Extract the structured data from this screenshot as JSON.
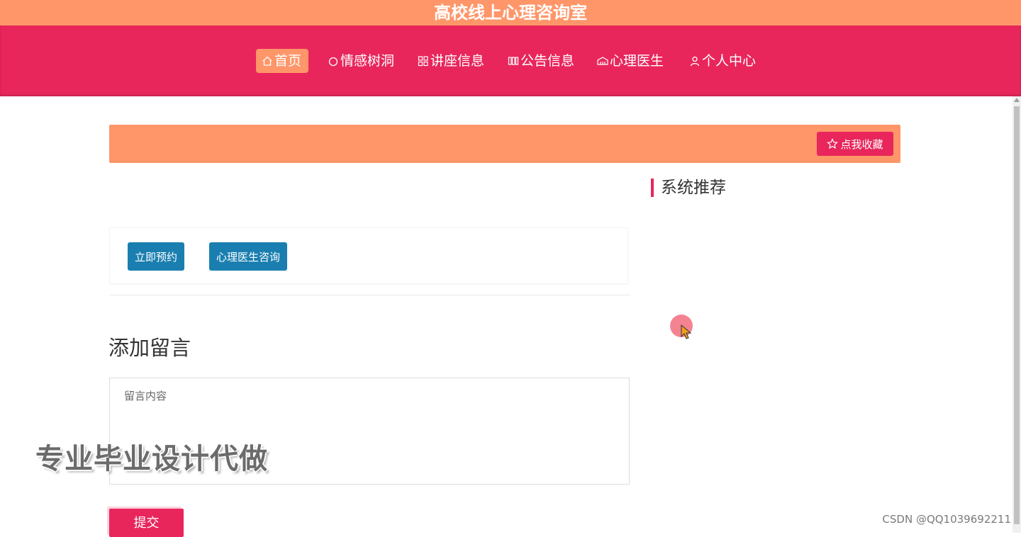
{
  "site": {
    "title": "高校线上心理咨询室"
  },
  "nav": {
    "items": [
      {
        "label": "首页",
        "icon": "home-icon"
      },
      {
        "label": "情感树洞",
        "icon": "circle-icon"
      },
      {
        "label": "讲座信息",
        "icon": "grid-icon"
      },
      {
        "label": "公告信息",
        "icon": "columns-icon"
      },
      {
        "label": "心理医生",
        "icon": "clinic-icon"
      },
      {
        "label": "个人中心",
        "icon": "user-icon"
      }
    ],
    "active_index": 0
  },
  "banner": {
    "collect_label": "点我收藏",
    "collect_icon": "star-icon"
  },
  "sidebar": {
    "title": "系统推荐"
  },
  "actions": {
    "appointment_label": "立即预约",
    "consult_label": "心理医生咨询"
  },
  "message": {
    "section_title": "添加留言",
    "placeholder": "留言内容",
    "value": "",
    "submit_label": "提交"
  },
  "overlay": {
    "ad_text": "专业毕业设计代做",
    "watermark": "CSDN @QQ1039692211"
  },
  "colors": {
    "accent_orange": "#ff9669",
    "accent_pink": "#e8265c",
    "button_blue": "#1a7fb0"
  }
}
